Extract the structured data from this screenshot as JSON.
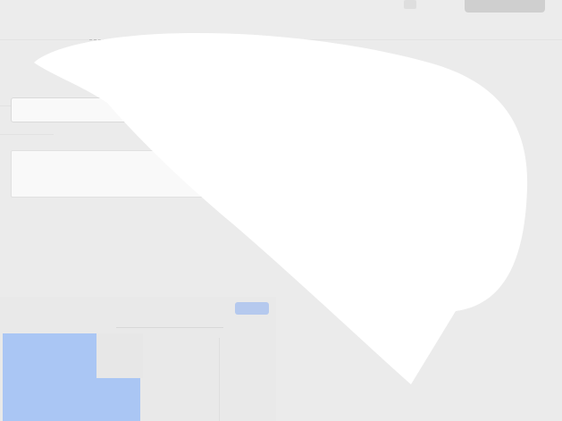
{
  "window": {
    "title": ""
  },
  "icons": {
    "clear": "×",
    "chevron": "chevron-down-icon",
    "trash": "trash-icon"
  },
  "colors": {
    "background": "#ebebeb",
    "card": "#f9f9f9",
    "accent_blue": "#aac6f4",
    "overlay": "#ffffff"
  }
}
